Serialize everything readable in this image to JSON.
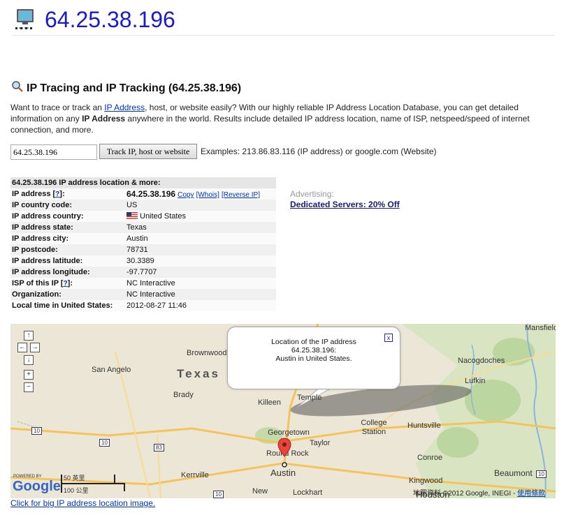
{
  "header": {
    "title": "64.25.38.196",
    "icon": "computer-monitor-icon"
  },
  "section": {
    "title": "IP Tracing and IP Tracking (64.25.38.196)",
    "icon": "magnifier-icon"
  },
  "intro": {
    "part1": "Want to trace or track an ",
    "link": "IP Address",
    "part2": ", host, or website easily? With our highly reliable IP Address Location Database, you can get detailed information on any ",
    "bold": "IP Address",
    "part3": " anywhere in the world. Results include detailed IP address location, name of ISP, netspeed/speed of internet connection, and more."
  },
  "search": {
    "value": "64.25.38.196",
    "button_label": "Track IP, host or website",
    "examples": "Examples: 213.86.83.116 (IP address) or google.com (Website)"
  },
  "table": {
    "header": "64.25.38.196 IP address location & more:",
    "ip_label": "IP address [",
    "ip_help": "?",
    "ip_label_end": "]:",
    "ip_value": "64.25.38.196",
    "copy": "Copy",
    "whois": "[Whois]",
    "reverse": "[Reverse IP]",
    "country_code_label": "IP country code:",
    "country_code": "US",
    "country_label": "IP address country:",
    "country": "United States",
    "state_label": "IP address state:",
    "state": "Texas",
    "city_label": "IP address city:",
    "city": "Austin",
    "postcode_label": "IP postcode:",
    "postcode": "78731",
    "lat_label": "IP address latitude:",
    "lat": "30.3389",
    "lon_label": "IP address longitude:",
    "lon": "-97.7707",
    "isp_label": "ISP of this IP [",
    "isp_help": "?",
    "isp_label_end": "]:",
    "isp": "NC Interactive",
    "org_label": "Organization:",
    "org": "NC Interactive",
    "time_label": "Local time in United States:",
    "time": "2012-08-27 11:46"
  },
  "advertising": {
    "label": "Advertising:",
    "link": "Dedicated Servers: 20% Off"
  },
  "map": {
    "state_label": "Texas",
    "places": {
      "san_angelo": "San Angelo",
      "brownwood": "Brownwood",
      "brady": "Brady",
      "killeen": "Killeen",
      "temple": "Temple",
      "georgetown": "Georgetown",
      "taylor": "Taylor",
      "round_rock": "Round Rock",
      "austin": "Austin",
      "college_station": "College Station",
      "huntsville": "Huntsville",
      "conroe": "Conroe",
      "nacogdoches": "Nacogdoches",
      "lufkin": "Lufkin",
      "mansfield": "Mansfield",
      "kerrville": "Kerrville",
      "kingwood": "Kingwood",
      "beaumont": "Beaumont",
      "houston": "Houston",
      "new": "New",
      "lockhart": "Lockhart"
    },
    "highways": [
      "10",
      "10",
      "83",
      "10",
      "10"
    ],
    "popup": {
      "line1": "Location of the IP address",
      "line2": "64.25.38.196:",
      "line3": "Austin in United States.",
      "close": "x"
    },
    "zoom": {
      "up": "↑",
      "left": "←",
      "right": "→",
      "down": "↓",
      "plus": "+",
      "minus": "−"
    },
    "powered_by": "POWERED BY",
    "google_logo": "Google",
    "scale_miles": "50 英里",
    "scale_km": "100 公里",
    "copyright": "地圖資料 ©2012 Google, INEGI - ",
    "terms": "使用條款"
  },
  "big_image_link": "Click for big IP address location image.",
  "colors": {
    "title": "#1a1acc",
    "link": "#0033bb",
    "marker": "#e8443a",
    "road": "#f4c45a",
    "forest": "#c4dba8"
  }
}
